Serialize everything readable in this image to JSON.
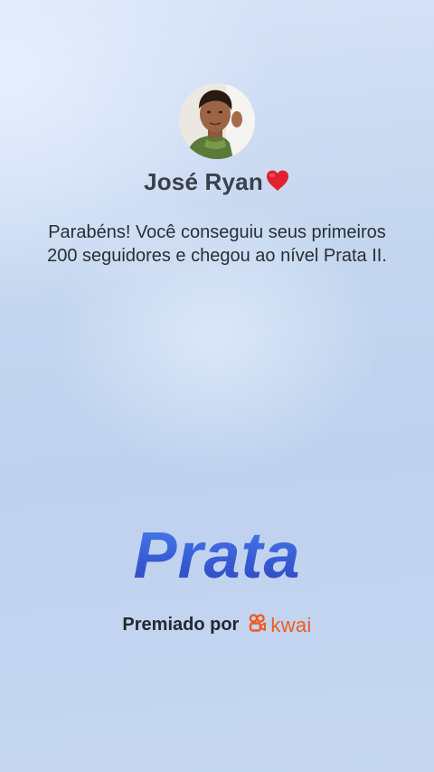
{
  "profile": {
    "name": "José Ryan",
    "name_emoji_icon": "red-heart-icon",
    "avatar_icon": "user-avatar"
  },
  "message": "Parabéns! Você conseguiu seus primeiros 200 seguidores e chegou ao nível Prata II.",
  "level": {
    "title": "Prata"
  },
  "awarded_by": {
    "label": "Premiado por",
    "brand": "kwai",
    "brand_color": "#f25a1f"
  },
  "colors": {
    "level_title": "#3d62d8",
    "background": "#c4d6ef"
  }
}
